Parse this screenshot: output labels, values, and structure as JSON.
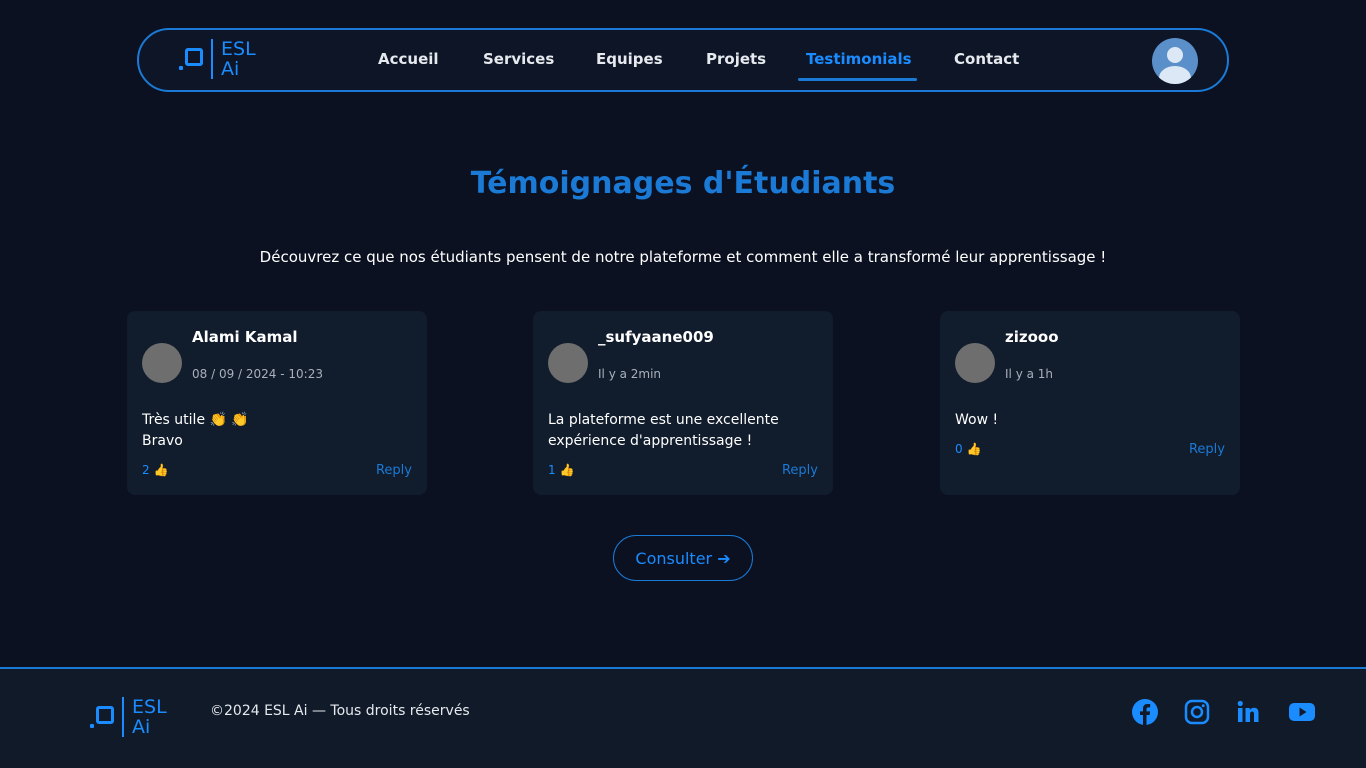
{
  "nav": {
    "logo_text": [
      "ESL",
      "Ai"
    ],
    "links": [
      {
        "label": "Accueil"
      },
      {
        "label": "Services"
      },
      {
        "label": "Equipes"
      },
      {
        "label": "Projets"
      },
      {
        "label": "Testimonials"
      },
      {
        "label": "Contact"
      }
    ],
    "active": "Testimonials",
    "avatar_icon": "user-avatar-icon"
  },
  "section": {
    "title": "Témoignages d'Étudiants",
    "subtitle": "Découvrez ce que nos étudiants pensent de notre plateforme et comment elle a transformé leur apprentissage !"
  },
  "testimonials": [
    {
      "name": "Alami Kamal",
      "time": "08 / 09 / 2024 - 10:23",
      "lines": [
        "Très utile 👏 👏",
        "Bravo"
      ],
      "likes": "2 👍",
      "reply": "Reply"
    },
    {
      "name": "_sufyaane009",
      "time": "Il y a 2min",
      "lines": [
        "La plateforme est une excellente",
        "expérience d'apprentissage !"
      ],
      "likes": "1 👍",
      "reply": "Reply"
    },
    {
      "name": "zizooo",
      "time": "Il y a 1h",
      "lines": [
        "Wow !"
      ],
      "likes": "0 👍",
      "reply": "Reply"
    }
  ],
  "cta": {
    "label": "Consulter ➔"
  },
  "footer": {
    "logo_text": [
      "ESL",
      "Ai"
    ],
    "copyright": "©2024 ESL Ai — Tous droits réservés",
    "social": [
      "facebook-icon",
      "instagram-icon",
      "linkedin-icon",
      "youtube-icon"
    ]
  },
  "colors": {
    "accent": "#1a7ad6",
    "background": "#0b1120",
    "card": "#111c2c"
  }
}
